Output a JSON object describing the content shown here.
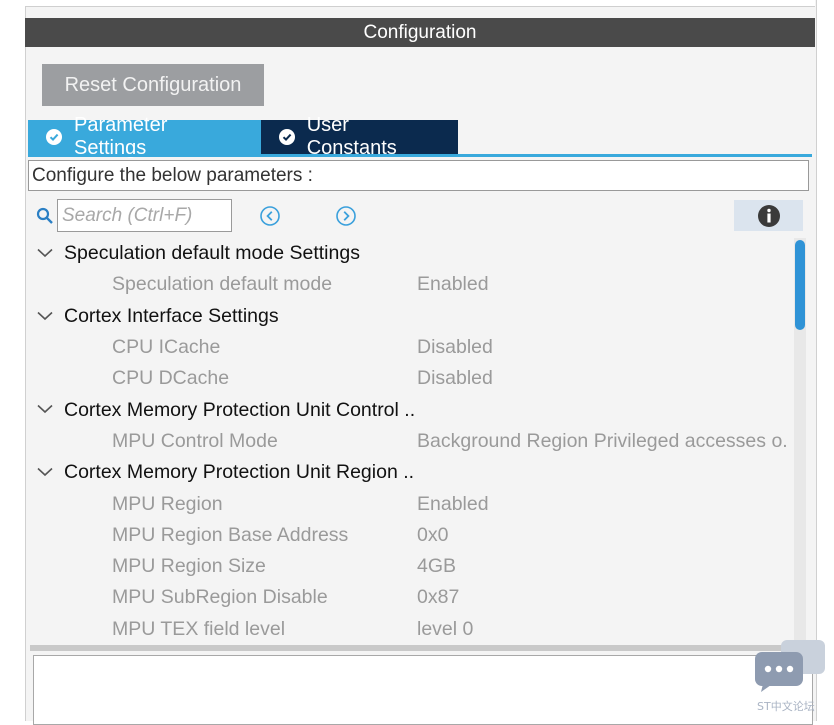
{
  "panel": {
    "title": "Configuration",
    "reset_label": "Reset Configuration"
  },
  "tabs": [
    {
      "label": "Parameter Settings",
      "active": true
    },
    {
      "label": "User Constants",
      "active": false
    }
  ],
  "description": "Configure the below parameters :",
  "search": {
    "placeholder": "Search (Ctrl+F)"
  },
  "tree": {
    "groups": [
      {
        "label": "Speculation default mode Settings",
        "params": [
          {
            "label": "Speculation default mode",
            "value": "Enabled"
          }
        ]
      },
      {
        "label": "Cortex Interface Settings",
        "params": [
          {
            "label": "CPU ICache",
            "value": "Disabled"
          },
          {
            "label": "CPU DCache",
            "value": "Disabled"
          }
        ]
      },
      {
        "label": "Cortex Memory Protection Unit Control ..",
        "params": [
          {
            "label": "MPU Control Mode",
            "value": "Background Region Privileged accesses o."
          }
        ]
      },
      {
        "label": "Cortex Memory Protection Unit Region ..",
        "params": [
          {
            "label": "MPU Region",
            "value": "Enabled"
          },
          {
            "label": "MPU Region Base Address",
            "value": "0x0"
          },
          {
            "label": "MPU Region Size",
            "value": "4GB"
          },
          {
            "label": "MPU SubRegion Disable",
            "value": "0x87"
          },
          {
            "label": "MPU TEX field level",
            "value": "level 0"
          }
        ]
      }
    ]
  },
  "icons": {
    "search": "search-icon",
    "prev": "previous-match-icon",
    "next": "next-match-icon",
    "info": "info-icon",
    "expand": "chevron-down-icon",
    "watermark": "chat-bubble-icon"
  },
  "watermark": {
    "text": "ST中文论坛"
  },
  "colors": {
    "title_bar": "#4a4a4a",
    "tab_active": "#39a9dc",
    "tab_inactive": "#0b2a4e",
    "scroll_thumb": "#2f93d6"
  }
}
